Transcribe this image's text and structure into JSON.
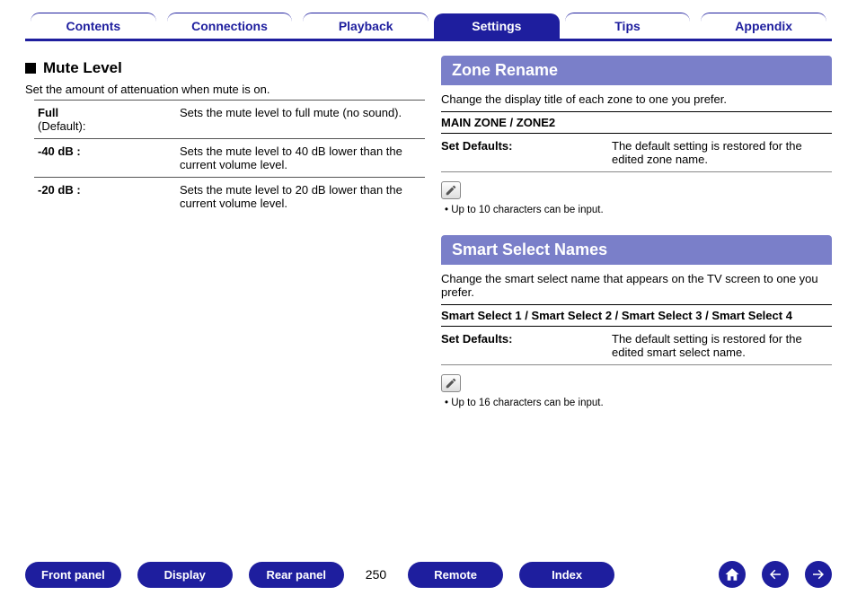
{
  "tabs": [
    {
      "label": "Contents",
      "active": false
    },
    {
      "label": "Connections",
      "active": false
    },
    {
      "label": "Playback",
      "active": false
    },
    {
      "label": "Settings",
      "active": true
    },
    {
      "label": "Tips",
      "active": false
    },
    {
      "label": "Appendix",
      "active": false
    }
  ],
  "left": {
    "title": "Mute Level",
    "desc": "Set the amount of attenuation when mute is on.",
    "rows": [
      {
        "key": "Full",
        "sub": "(Default):",
        "val": "Sets the mute level to full mute (no sound)."
      },
      {
        "key": "-40 dB :",
        "sub": "",
        "val": "Sets the mute level to 40 dB lower than the current volume level."
      },
      {
        "key": "-20 dB :",
        "sub": "",
        "val": "Sets the mute level to 20 dB lower than the current volume level."
      }
    ]
  },
  "right": {
    "zone": {
      "title": "Zone Rename",
      "desc": "Change the display title of each zone to one you prefer.",
      "subhdr": "MAIN ZONE / ZONE2",
      "kv": {
        "k": "Set Defaults:",
        "v": "The default setting is restored for the edited zone name."
      },
      "note": "Up to 10 characters can be input."
    },
    "smart": {
      "title": "Smart Select Names",
      "desc": "Change the smart select name that appears on the TV screen to one you prefer.",
      "subhdr": "Smart Select 1 / Smart Select 2 / Smart Select 3 / Smart Select 4",
      "kv": {
        "k": "Set Defaults:",
        "v": "The default setting is restored for the edited smart select name."
      },
      "note": "Up to 16 characters can be input."
    }
  },
  "footer": {
    "buttons": [
      "Front panel",
      "Display",
      "Rear panel"
    ],
    "page": "250",
    "buttons2": [
      "Remote",
      "Index"
    ]
  }
}
